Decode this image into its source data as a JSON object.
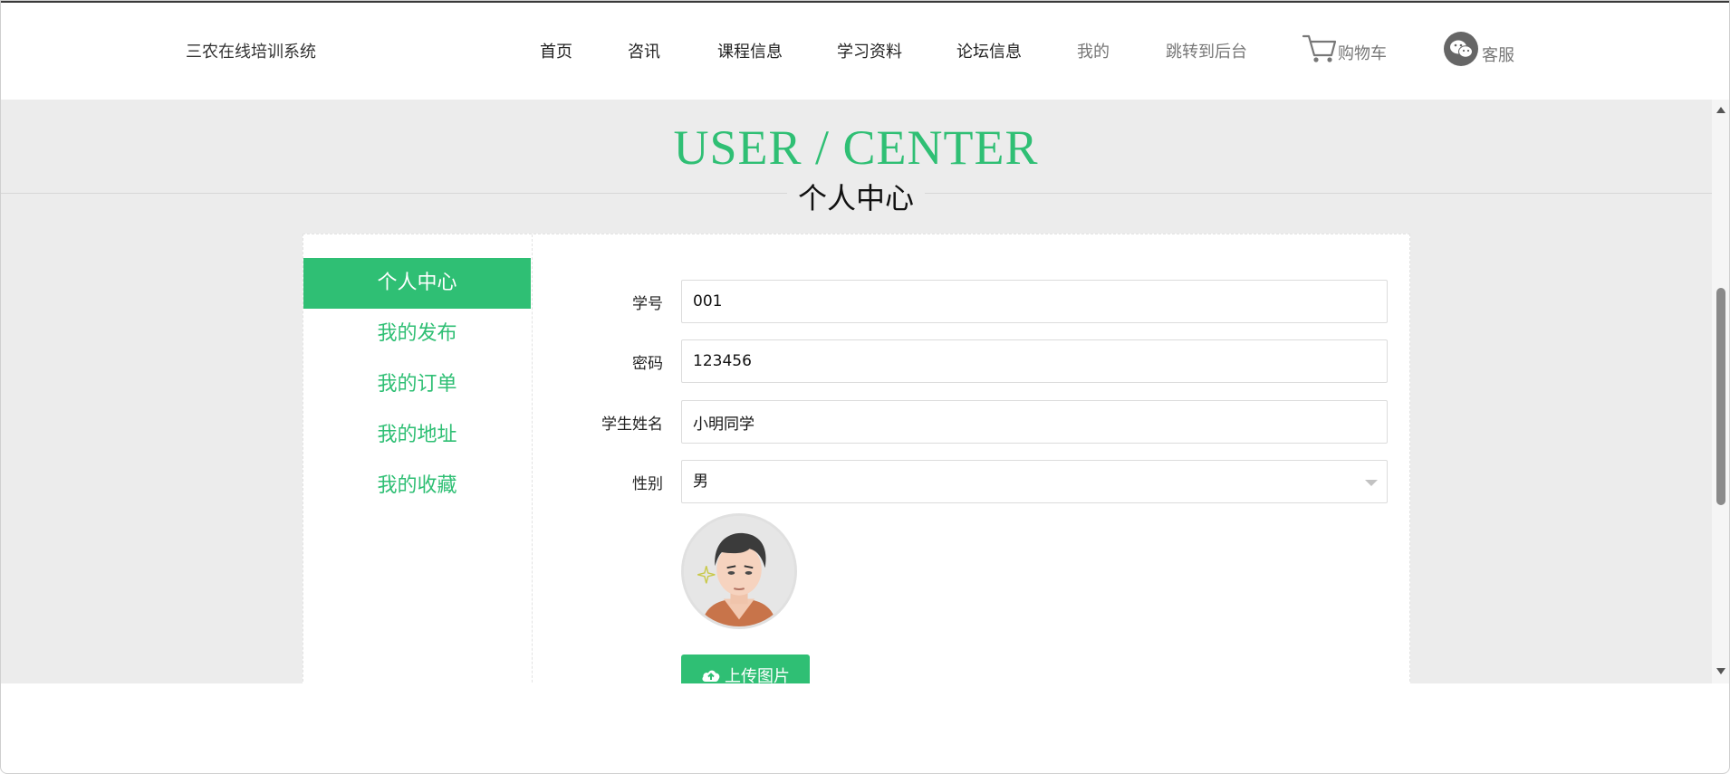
{
  "header": {
    "brand": "三农在线培训系统",
    "nav": [
      {
        "label": "首页"
      },
      {
        "label": "咨讯"
      },
      {
        "label": "课程信息"
      },
      {
        "label": "学习资料"
      },
      {
        "label": "论坛信息"
      },
      {
        "label": "我的"
      },
      {
        "label": "跳转到后台"
      }
    ],
    "cart_label": "购物车",
    "service_label": "客服"
  },
  "banner": {
    "title": "USER / CENTER",
    "subtitle": "个人中心"
  },
  "sidebar": {
    "items": [
      {
        "label": "个人中心",
        "active": true
      },
      {
        "label": "我的发布",
        "active": false
      },
      {
        "label": "我的订单",
        "active": false
      },
      {
        "label": "我的地址",
        "active": false
      },
      {
        "label": "我的收藏",
        "active": false
      }
    ]
  },
  "form": {
    "fields": [
      {
        "label": "学号",
        "value": "001"
      },
      {
        "label": "密码",
        "value": "123456"
      },
      {
        "label": "学生姓名",
        "value": "小明同学"
      },
      {
        "label": "性别",
        "value": "男"
      }
    ],
    "upload_label": "上传图片"
  },
  "colors": {
    "accent": "#2fbf74",
    "page_bg": "#ececec"
  },
  "icons": [
    "cart-icon",
    "wechat-icon",
    "cloud-upload-icon",
    "chevron-down-icon"
  ]
}
